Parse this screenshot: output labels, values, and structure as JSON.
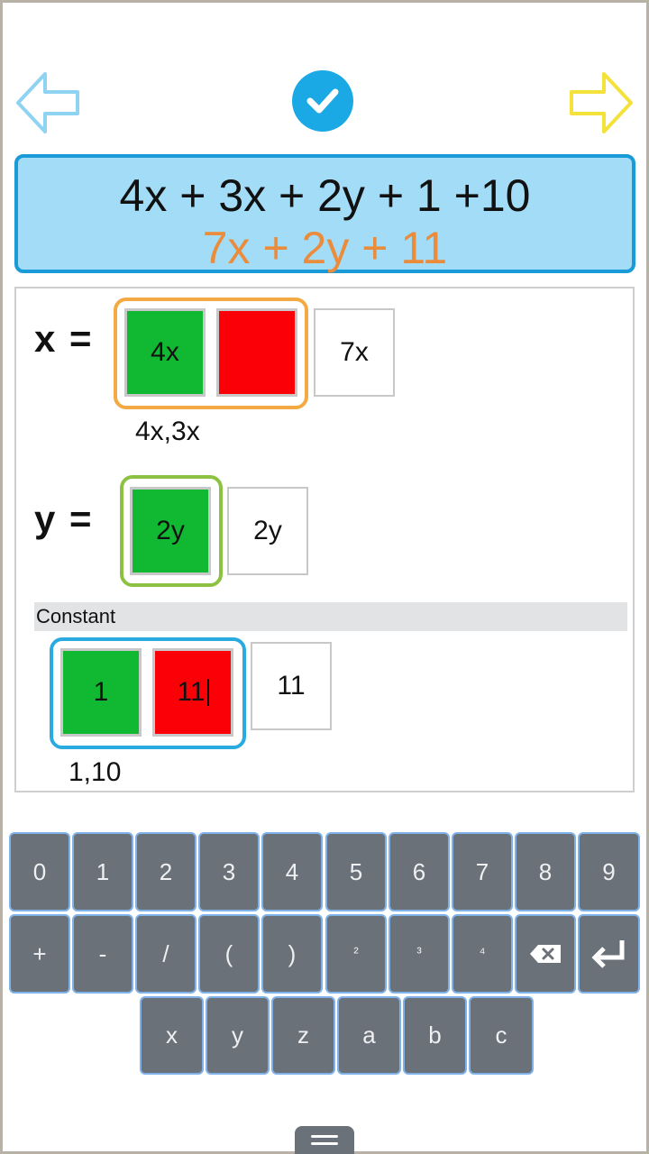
{
  "colors": {
    "accent_blue": "#1ba9e6",
    "panel_bg": "#a2dcf6",
    "simplified_text": "#ea8c3c",
    "tile_green": "#11b832",
    "tile_red": "#fb0006",
    "group_x_border": "#f3aa45",
    "group_y_border": "#8cc142",
    "group_const_border": "#29abe2",
    "key_bg": "#6b7178",
    "key_border": "#7fb2e8"
  },
  "icons": {
    "back": "arrow-left-icon",
    "check": "check-circle-icon",
    "next": "arrow-right-icon",
    "backspace": "backspace-icon",
    "enter": "enter-icon",
    "handle": "menu-handle-icon"
  },
  "expression": {
    "original": "4x + 3x + 2y + 1 +10",
    "simplified": "7x + 2y + 11"
  },
  "x_group": {
    "label": "x =",
    "tiles": [
      "4x",
      ""
    ],
    "result": "7x",
    "terms": "4x,3x"
  },
  "y_group": {
    "label": "y =",
    "tiles": [
      "2y"
    ],
    "result": "2y"
  },
  "constant_group": {
    "label": "Constant",
    "tiles": [
      "1",
      "11"
    ],
    "result": "11",
    "terms": "1,10"
  },
  "keyboard": {
    "row1": [
      "0",
      "1",
      "2",
      "3",
      "4",
      "5",
      "6",
      "7",
      "8",
      "9"
    ],
    "row2": [
      "+",
      "-",
      "/",
      "(",
      ")",
      "²",
      "³",
      "⁴"
    ],
    "row3": [
      "x",
      "y",
      "z",
      "a",
      "b",
      "c"
    ]
  }
}
